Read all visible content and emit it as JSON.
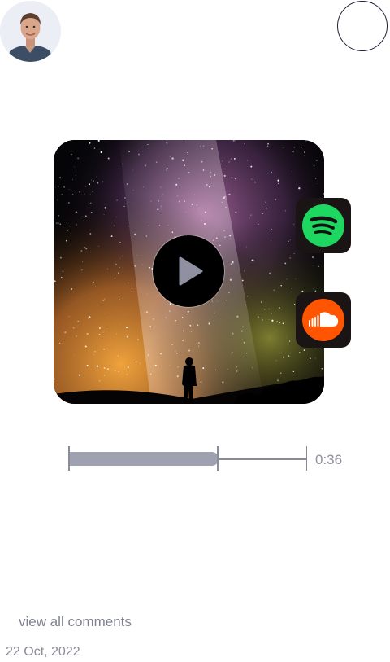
{
  "header": {
    "avatar_icon": "user-portrait",
    "action_button_icon": "empty-circle"
  },
  "player": {
    "artwork_icon": "starry-night-silhouette",
    "play_icon": "play-triangle",
    "progress_fraction": 0.63,
    "time": "0:36"
  },
  "services": [
    {
      "name_icon": "spotify-icon",
      "color": "#1ed760"
    },
    {
      "name_icon": "soundcloud-icon",
      "color": "#ff5500"
    }
  ],
  "footer": {
    "comments_link": "view all comments",
    "date": "22 Oct, 2022"
  },
  "colors": {
    "progress_fill": "#9fa1b0",
    "muted_text": "#8e909c"
  }
}
